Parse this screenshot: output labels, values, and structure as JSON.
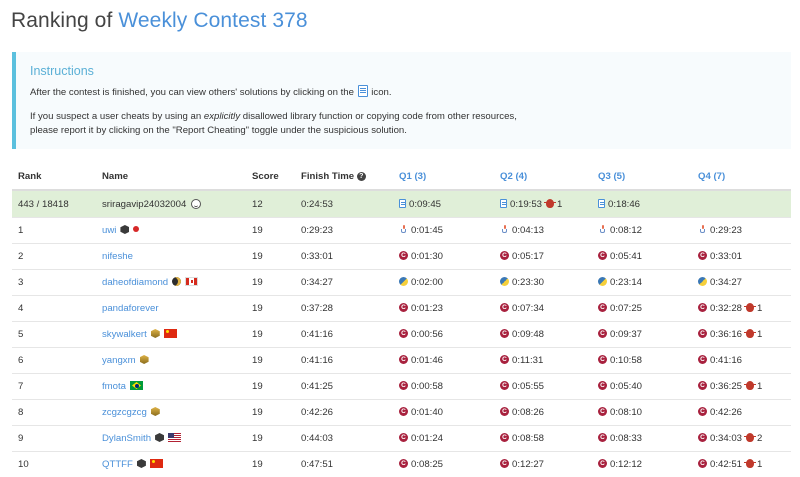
{
  "title": {
    "prefix": "Ranking of ",
    "contest": "Weekly Contest 378"
  },
  "instructions": {
    "heading": "Instructions",
    "line1_before": "After the contest is finished, you can view others' solutions by clicking on the ",
    "line1_after": " icon.",
    "line2_before": "If you suspect a user cheats by using an ",
    "line2_em": "explicitly",
    "line2_after": " disallowed library function or copying code from other resources,",
    "line3": "please report it by clicking on the \"Report Cheating\" toggle under the suspicious solution."
  },
  "columns": {
    "rank": "Rank",
    "name": "Name",
    "score": "Score",
    "finish": "Finish Time",
    "q1": "Q1 (3)",
    "q2": "Q2 (4)",
    "q3": "Q3 (5)",
    "q4": "Q4 (7)"
  },
  "me": {
    "rank": "443 / 18418",
    "name": "sriragavip24032004",
    "score": "12",
    "finish": "0:24:53",
    "q1": "0:09:45",
    "q2": "0:19:53",
    "q2_penalty": "1",
    "q3": "0:18:46",
    "q4": ""
  },
  "rows": [
    {
      "rank": "1",
      "name": "uwi",
      "score": "19",
      "finish": "0:29:23",
      "q1": "0:01:45",
      "q2": "0:04:13",
      "q3": "0:08:12",
      "q4": "0:29:23",
      "q4_penalty": ""
    },
    {
      "rank": "2",
      "name": "nifeshe",
      "score": "19",
      "finish": "0:33:01",
      "q1": "0:01:30",
      "q2": "0:05:17",
      "q3": "0:05:41",
      "q4": "0:33:01",
      "q4_penalty": ""
    },
    {
      "rank": "3",
      "name": "daheofdiamond",
      "score": "19",
      "finish": "0:34:27",
      "q1": "0:02:00",
      "q2": "0:23:30",
      "q3": "0:23:14",
      "q4": "0:34:27",
      "q4_penalty": ""
    },
    {
      "rank": "4",
      "name": "pandaforever",
      "score": "19",
      "finish": "0:37:28",
      "q1": "0:01:23",
      "q2": "0:07:34",
      "q3": "0:07:25",
      "q4": "0:32:28",
      "q4_penalty": "1"
    },
    {
      "rank": "5",
      "name": "skywalkert",
      "score": "19",
      "finish": "0:41:16",
      "q1": "0:00:56",
      "q2": "0:09:48",
      "q3": "0:09:37",
      "q4": "0:36:16",
      "q4_penalty": "1"
    },
    {
      "rank": "6",
      "name": "yangxm",
      "score": "19",
      "finish": "0:41:16",
      "q1": "0:01:46",
      "q2": "0:11:31",
      "q3": "0:10:58",
      "q4": "0:41:16",
      "q4_penalty": ""
    },
    {
      "rank": "7",
      "name": "fmota",
      "score": "19",
      "finish": "0:41:25",
      "q1": "0:00:58",
      "q2": "0:05:55",
      "q3": "0:05:40",
      "q4": "0:36:25",
      "q4_penalty": "1"
    },
    {
      "rank": "8",
      "name": "zcgzcgzcg",
      "score": "19",
      "finish": "0:42:26",
      "q1": "0:01:40",
      "q2": "0:08:26",
      "q3": "0:08:10",
      "q4": "0:42:26",
      "q4_penalty": ""
    },
    {
      "rank": "9",
      "name": "DylanSmith",
      "score": "19",
      "finish": "0:44:03",
      "q1": "0:01:24",
      "q2": "0:08:58",
      "q3": "0:08:33",
      "q4": "0:34:03",
      "q4_penalty": "2"
    },
    {
      "rank": "10",
      "name": "QTTFF",
      "score": "19",
      "finish": "0:47:51",
      "q1": "0:08:25",
      "q2": "0:12:27",
      "q3": "0:12:12",
      "q4": "0:42:51",
      "q4_penalty": "1"
    }
  ]
}
